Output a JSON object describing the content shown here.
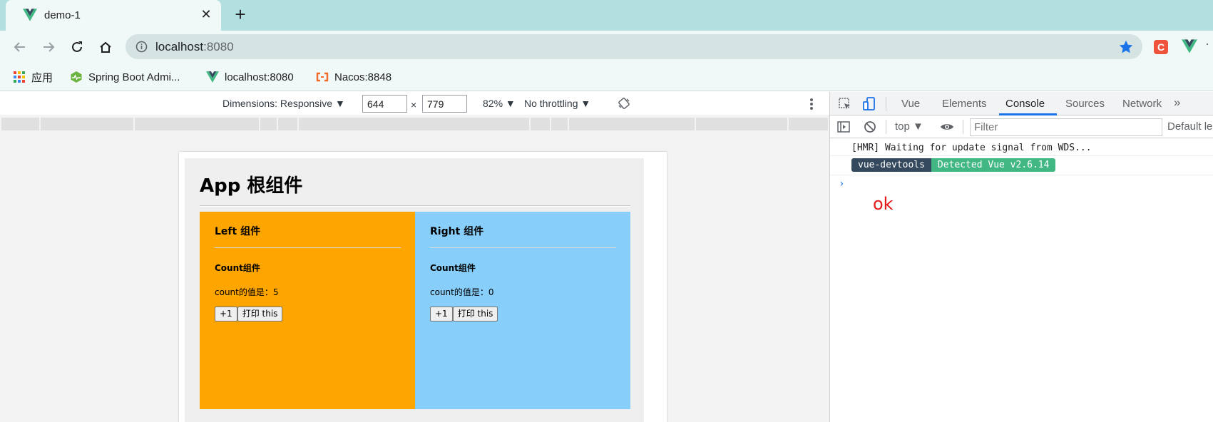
{
  "browser": {
    "tab_title": "demo-1",
    "new_tab_label": "+",
    "close_tab_label": "✕",
    "url_host": "localhost",
    "url_port": ":8080"
  },
  "bookmarks": [
    {
      "label": "应用",
      "icon": "apps-grid-icon"
    },
    {
      "label": "Spring Boot Admi...",
      "icon": "spring-boot-admin-icon"
    },
    {
      "label": "localhost:8080",
      "icon": "vue-logo-icon"
    },
    {
      "label": "Nacos:8848",
      "icon": "nacos-icon"
    }
  ],
  "device_toolbar": {
    "dimensions_label": "Dimensions: Responsive ▼",
    "width": "644",
    "times": "×",
    "height": "779",
    "zoom": "82% ▼",
    "throttling": "No throttling ▼"
  },
  "app": {
    "title": "App 根组件",
    "left": {
      "title": "Left 组件",
      "count_title": "Count组件",
      "count_text": "count的值是：5",
      "plus_label": "+1",
      "print_label": "打印 this"
    },
    "right": {
      "title": "Right 组件",
      "count_title": "Count组件",
      "count_text": "count的值是：0",
      "plus_label": "+1",
      "print_label": "打印 this"
    },
    "colors": {
      "left_bg": "#ffa500",
      "right_bg": "#87cefa",
      "app_bg": "#efefef"
    }
  },
  "devtools": {
    "tabs": [
      "Vue",
      "Elements",
      "Console",
      "Sources",
      "Network"
    ],
    "active_tab": "Console",
    "more_tabs": "»",
    "context": "top ▼",
    "filter_placeholder": "Filter",
    "levels": "Default le",
    "console": {
      "hmr_message": "[HMR] Waiting for update signal from WDS...",
      "badge_left": "vue-devtools",
      "badge_right": "Detected Vue v2.6.14",
      "prompt": "›",
      "output": "ok"
    }
  }
}
